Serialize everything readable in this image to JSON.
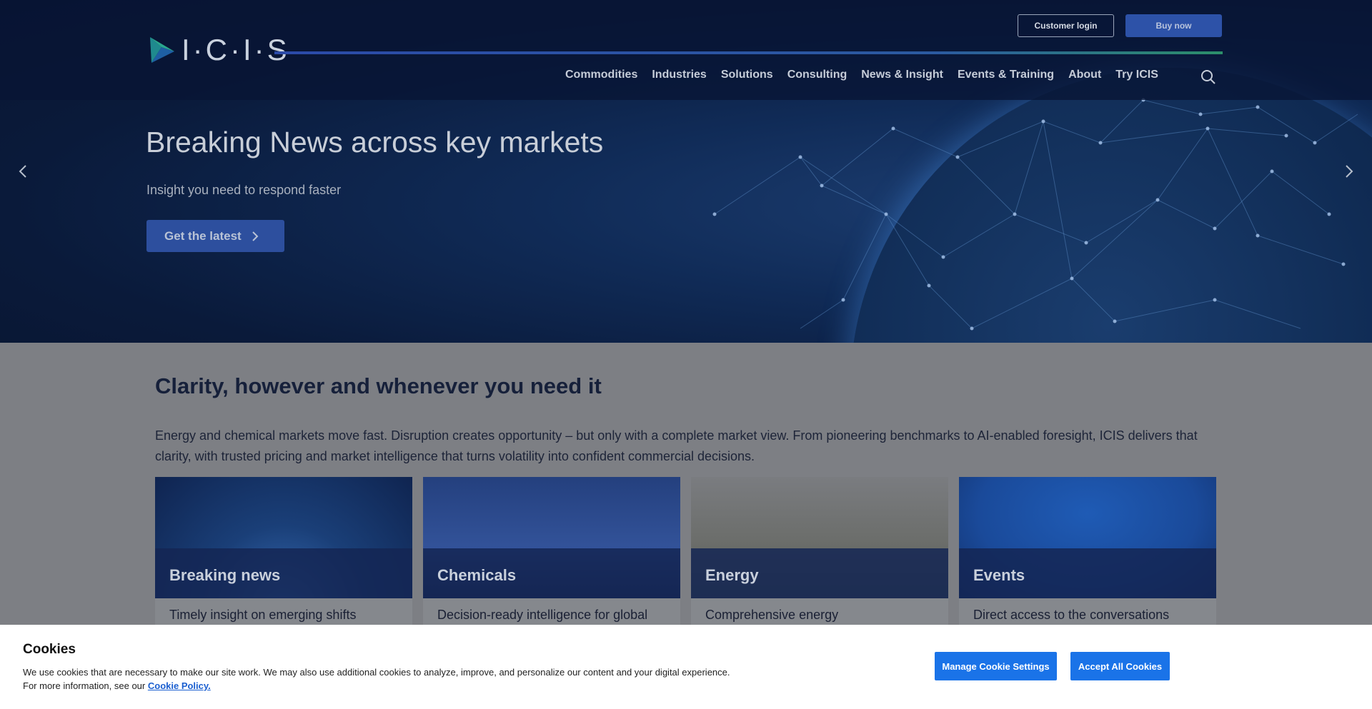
{
  "header": {
    "logo_text": "I·C·I·S",
    "customer_login": "Customer login",
    "buy_now": "Buy now",
    "nav": [
      {
        "label": "Commodities"
      },
      {
        "label": "Industries"
      },
      {
        "label": "Solutions"
      },
      {
        "label": "Consulting"
      },
      {
        "label": "News & Insight"
      },
      {
        "label": "Events & Training"
      },
      {
        "label": "About"
      },
      {
        "label": "Try ICIS"
      }
    ],
    "search_icon": "search-icon"
  },
  "hero": {
    "title": "Breaking News across key markets",
    "subtitle": "Insight you need to respond faster",
    "cta": "Get the latest",
    "prev_icon": "chevron-left-icon",
    "next_icon": "chevron-right-icon"
  },
  "intro": {
    "title": "Clarity, however and whenever you need it",
    "body": "Energy and chemical markets move fast. Disruption creates opportunity – but only with a complete market view. From pioneering benchmarks to AI-enabled foresight, ICIS delivers that clarity, with trusted pricing and market intelligence that turns volatility into confident commercial decisions."
  },
  "cards": [
    {
      "title": "Breaking news",
      "desc": "Timely insight on emerging shifts"
    },
    {
      "title": "Chemicals",
      "desc": "Decision-ready intelligence for global"
    },
    {
      "title": "Energy",
      "desc": "Comprehensive energy"
    },
    {
      "title": "Events",
      "desc": "Direct access to the conversations"
    }
  ],
  "cookies": {
    "title": "Cookies",
    "text": "We use cookies that are necessary to make our site work. We may also use additional cookies to analyze, improve, and personalize our content and your digital experience. For more information, see our",
    "link": "Cookie Policy.",
    "manage": "Manage Cookie Settings",
    "accept": "Accept All Cookies"
  },
  "colors": {
    "brand_blue": "#2d52a8",
    "cookie_button": "#1a73e8"
  }
}
